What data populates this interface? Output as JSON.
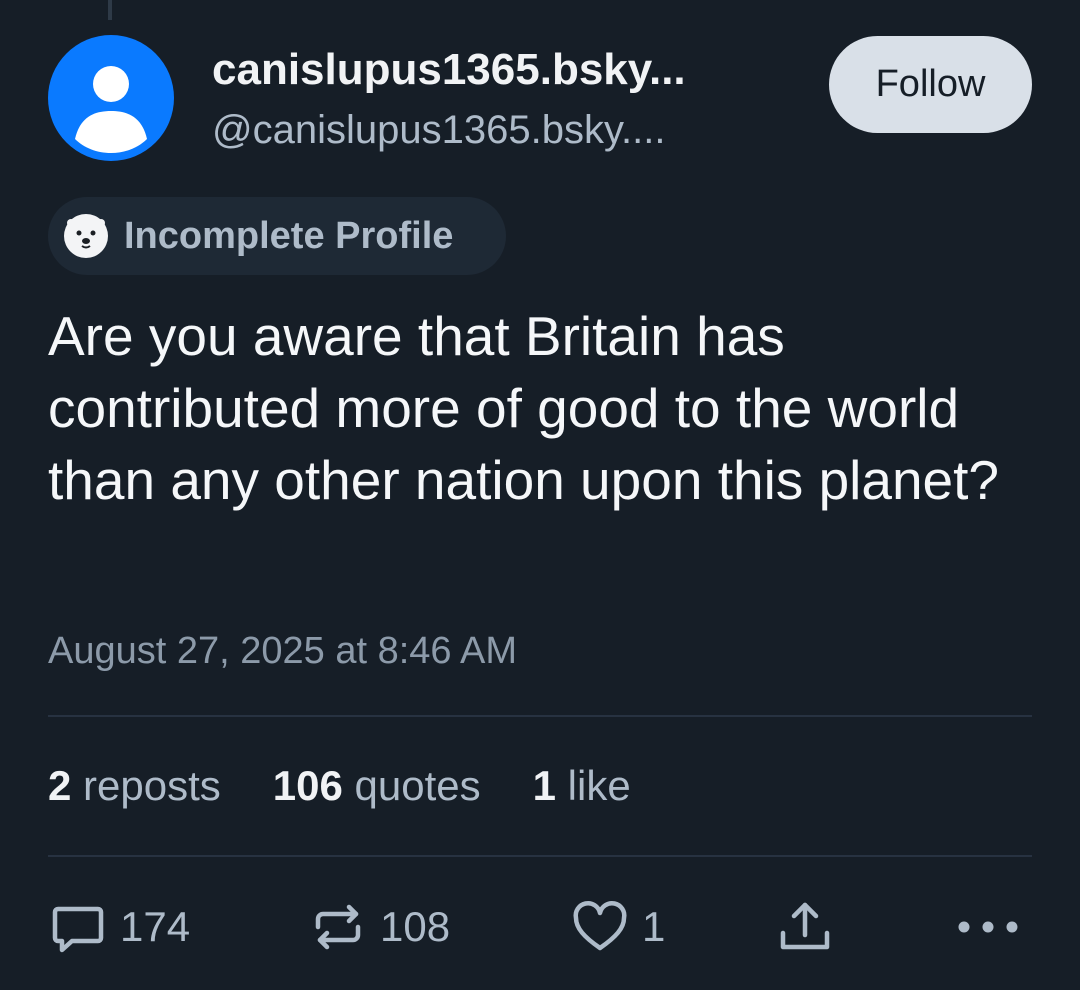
{
  "author": {
    "display_name": "canislupus1365.bsky...",
    "handle": "@canislupus1365.bsky....",
    "follow_label": "Follow",
    "badge_label": "Incomplete Profile",
    "avatar_color": "#0a7aff"
  },
  "post": {
    "text": "Are you aware that Britain has contributed more of good to the world than any other nation upon this planet?",
    "timestamp": "August 27, 2025 at 8:46 AM"
  },
  "stats": {
    "reposts_count": "2",
    "reposts_label": "reposts",
    "quotes_count": "106",
    "quotes_label": "quotes",
    "likes_count": "1",
    "likes_label": "like"
  },
  "actions": {
    "reply_count": "174",
    "repost_count": "108",
    "like_count": "1"
  },
  "icons": {
    "reply": "speech-bubble-icon",
    "repost": "repost-arrows-icon",
    "like": "heart-icon",
    "share": "share-upload-icon",
    "more": "ellipsis-icon",
    "badge": "polar-bear-icon"
  },
  "colors": {
    "background": "#161e27",
    "text_primary": "#f1f3f5",
    "text_secondary": "#aebbc9",
    "follow_bg": "#d9e0e8"
  }
}
